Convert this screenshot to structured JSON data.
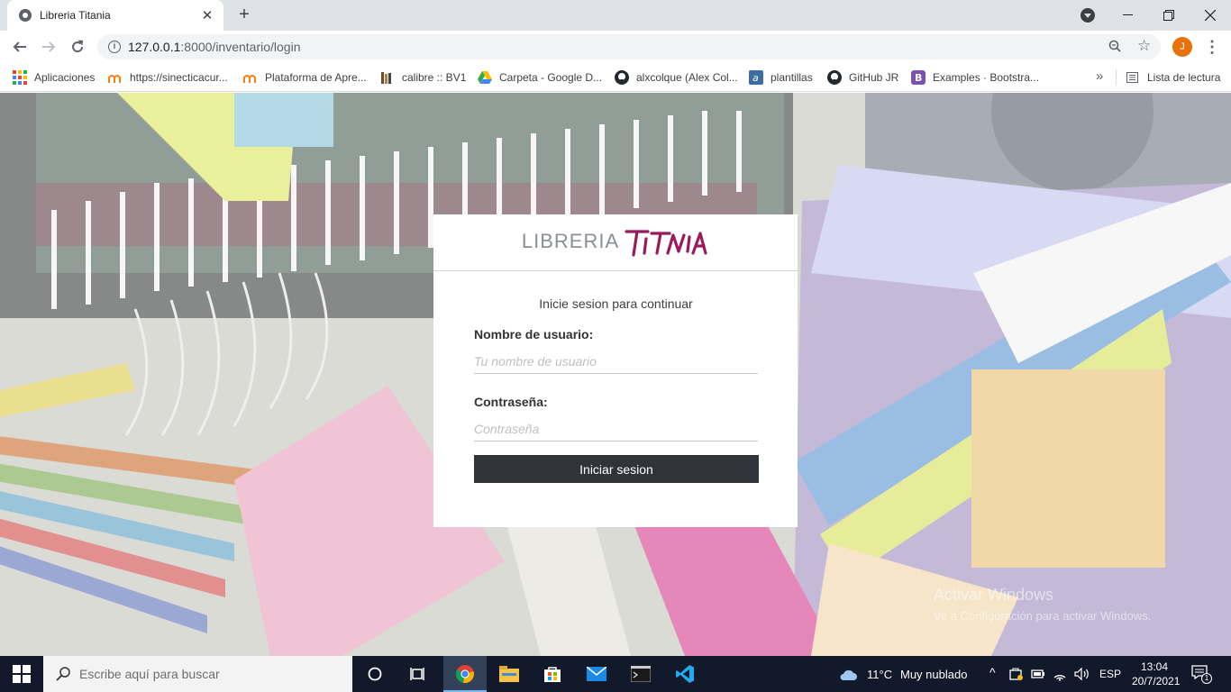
{
  "browser": {
    "tab_title": "Libreria Titania",
    "tab_close": "✕",
    "new_tab": "+",
    "url_host": "127.0.0.1",
    "url_rest": ":8000/inventario/login",
    "profile_initial": "J",
    "icons": [
      "back-icon",
      "forward-icon",
      "reload-icon",
      "info-icon",
      "zoom-icon",
      "star-icon",
      "menu-icon"
    ]
  },
  "bookmarks": {
    "items": [
      {
        "label": "Aplicaciones",
        "icon": "apps-icon"
      },
      {
        "label": "https://sinecticacur...",
        "icon": "moodle-icon"
      },
      {
        "label": "Plataforma de Apre...",
        "icon": "moodle-icon"
      },
      {
        "label": "calibre :: BV1",
        "icon": "books-icon"
      },
      {
        "label": "Carpeta - Google D...",
        "icon": "drive-icon"
      },
      {
        "label": "alxcolque (Alex Col...",
        "icon": "github-icon"
      },
      {
        "label": "plantillas",
        "icon": "a-icon"
      },
      {
        "label": "GitHub JR",
        "icon": "github-icon"
      },
      {
        "label": "Examples · Bootstra...",
        "icon": "bootstrap-icon"
      }
    ],
    "more": "»",
    "reading_list": "Lista de lectura"
  },
  "login": {
    "logo_word": "LIBRERIA",
    "logo_script": "TITANIA",
    "subtitle": "Inicie sesion para continuar",
    "username_label": "Nombre de usuario:",
    "username_placeholder": "Tu nombre de usuario",
    "password_label": "Contraseña:",
    "password_placeholder": "Contraseña",
    "submit_label": "Iniciar sesion"
  },
  "watermark": {
    "title": "Activar Windows",
    "subtitle": "Ve a Configuración para activar Windows."
  },
  "taskbar": {
    "search_placeholder": "Escribe aquí para buscar",
    "weather_temp": "11°C",
    "weather_text": "Muy nublado",
    "language": "ESP",
    "time": "13:04",
    "date": "20/7/2021",
    "notifications": "1"
  },
  "colors": {
    "accent_logo": "#9b1b5a",
    "button_dark": "#30343a",
    "taskbar": "#12192a"
  }
}
